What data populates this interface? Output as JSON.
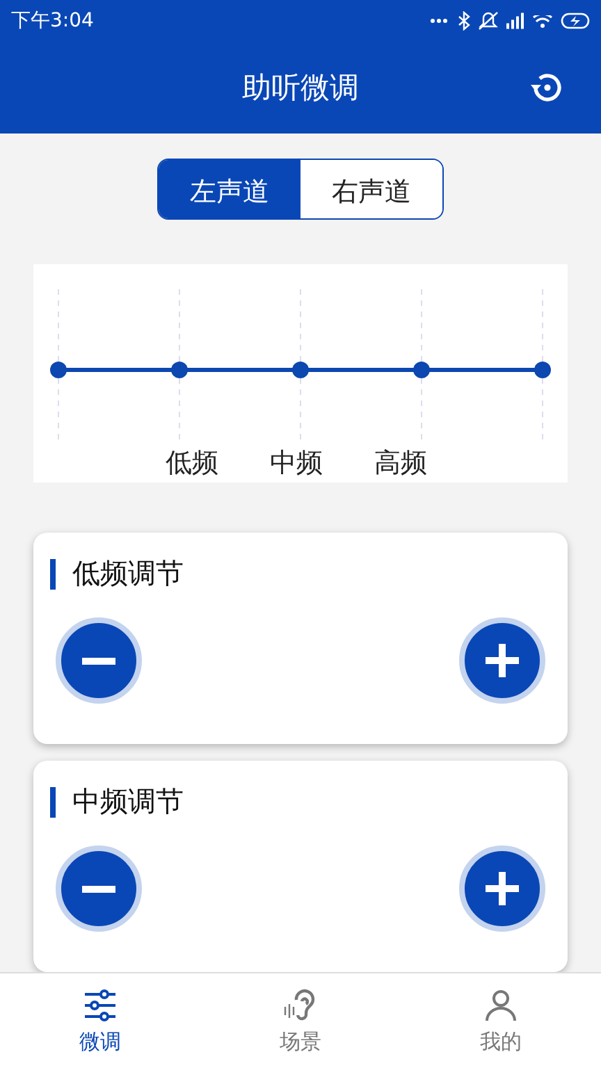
{
  "status_bar": {
    "time": "下午3:04"
  },
  "header": {
    "title": "助听微调"
  },
  "channels": [
    {
      "label": "左声道",
      "selected": true
    },
    {
      "label": "右声道",
      "selected": false
    }
  ],
  "eq_labels": [
    "低频",
    "中频",
    "高频"
  ],
  "bands": [
    {
      "title": "低频调节"
    },
    {
      "title": "中频调节"
    }
  ],
  "tab_bar": [
    {
      "label": "微调",
      "kind": "sliders",
      "selected": true
    },
    {
      "label": "场景",
      "kind": "ear",
      "selected": false
    },
    {
      "label": "我的",
      "kind": "person",
      "selected": false
    }
  ]
}
